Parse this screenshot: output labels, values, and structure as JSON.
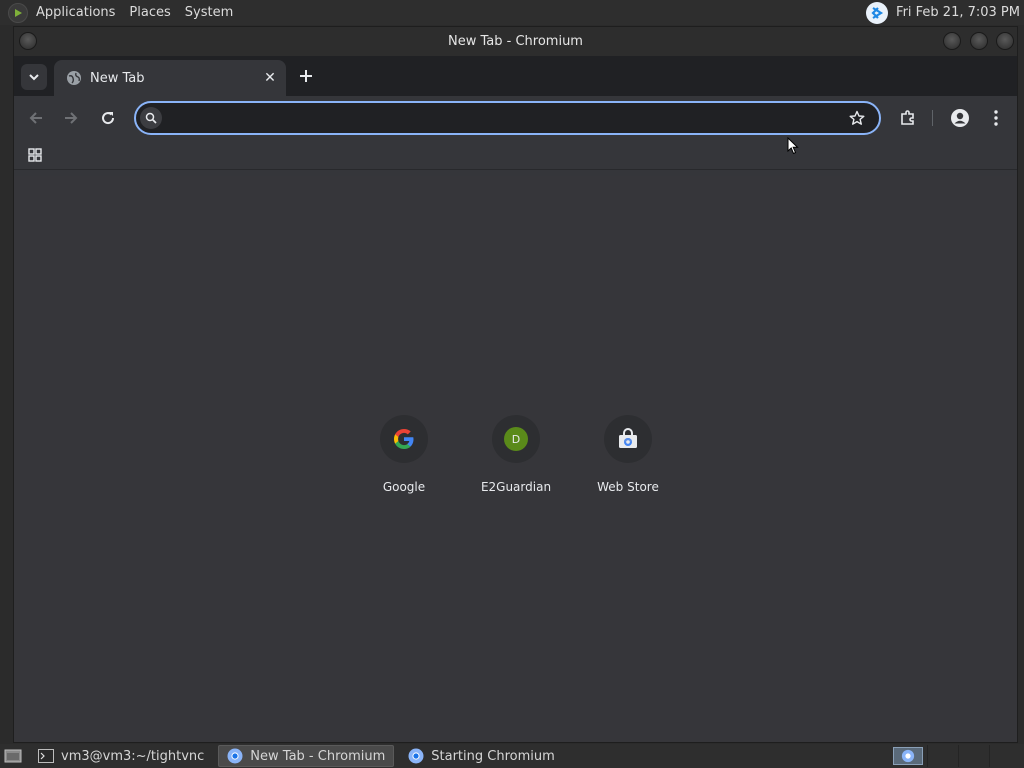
{
  "top_panel": {
    "menus": [
      "Applications",
      "Places",
      "System"
    ],
    "clock": "Fri Feb 21,  7:03 PM"
  },
  "window": {
    "title": "New Tab - Chromium"
  },
  "tabs": [
    {
      "title": "New Tab",
      "close_glyph": "✕"
    }
  ],
  "toolbar": {
    "omnibox_value": "",
    "omnibox_placeholder": ""
  },
  "shortcuts": [
    {
      "label": "Google",
      "icon": "google-g-icon"
    },
    {
      "label": "E2Guardian",
      "icon": "letter-d-icon",
      "letter": "D",
      "color": "#5a8a1a"
    },
    {
      "label": "Web Store",
      "icon": "web-store-icon"
    }
  ],
  "taskbar": {
    "items": [
      {
        "label": "vm3@vm3:~/tightvnc",
        "icon": "terminal-icon",
        "active": false
      },
      {
        "label": "New Tab - Chromium",
        "icon": "chromium-icon",
        "active": true
      },
      {
        "label": "Starting Chromium",
        "icon": "chromium-icon",
        "active": false
      }
    ]
  },
  "colors": {
    "accent": "#8ab4f8",
    "ntp_background": "#36363a",
    "tabstrip": "#202124"
  }
}
